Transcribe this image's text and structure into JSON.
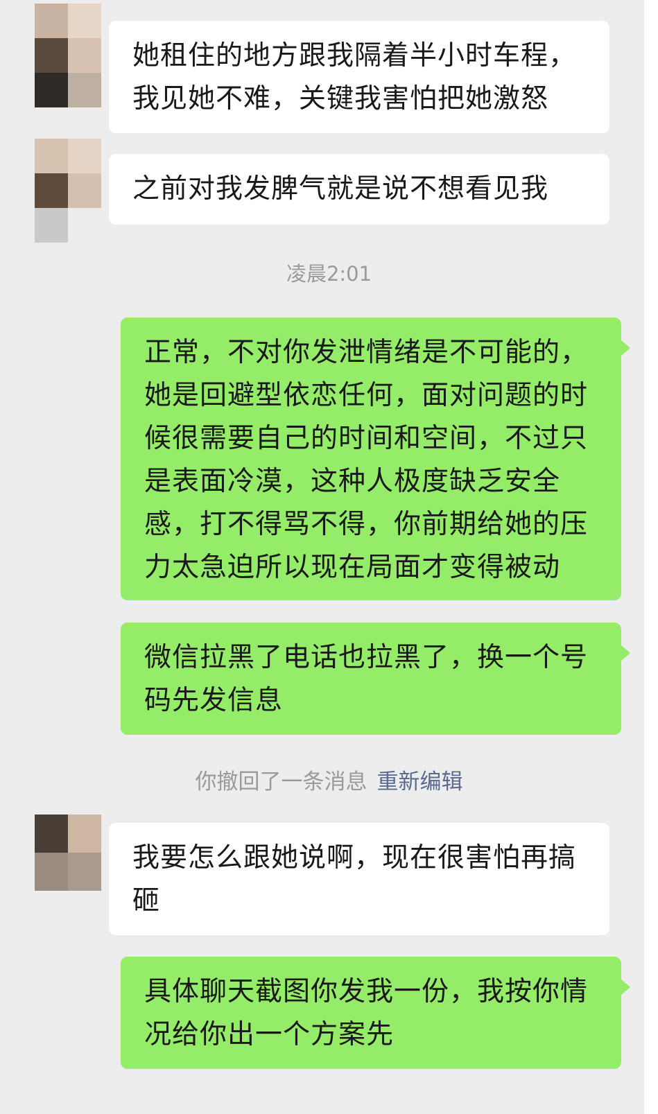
{
  "messages": [
    {
      "side": "in",
      "lines": [
        "她租住的地方跟我隔着半小时车程，",
        "我见她不难，关键我害怕把她激怒"
      ]
    },
    {
      "side": "in",
      "lines": [
        "之前对我发脾气就是说不想看见我"
      ]
    },
    {
      "side": "out",
      "lines": [
        "正常，不对你发泄情绪是不可能的，",
        "她是回避型依恋任何，面对问题的时",
        "候很需要自己的时间和空间，不过只",
        "是表面冷漠，这种人极度缺乏安全",
        "感，打不得骂不得，你前期给她的压",
        "力太急迫所以现在局面才变得被动"
      ]
    },
    {
      "side": "out",
      "lines": [
        "微信拉黑了电话也拉黑了，换一个号",
        "码先发信息"
      ]
    },
    {
      "side": "in",
      "lines": [
        "我要怎么跟她说啊，现在很害怕再搞",
        "砸"
      ]
    },
    {
      "side": "out",
      "lines": [
        "具体聊天截图你发我一份，我按你情",
        "况给你出一个方案先"
      ]
    }
  ],
  "timestamp": "凌晨2:01",
  "recall": {
    "text": "你撤回了一条消息",
    "edit_link": "重新编辑"
  },
  "colors": {
    "background": "#ededed",
    "incoming_bubble": "#ffffff",
    "outgoing_bubble": "#95ec69",
    "link": "#5a6b8f"
  },
  "avatars": [
    {
      "tiles": [
        "#c9b3a3",
        "#e6d6c8",
        "#5a4a3e",
        "#d8c3b3",
        "#2e2a26",
        "#bfb0a4"
      ]
    },
    {
      "tiles": [
        "#d8c2b0",
        "#e6d5c6",
        "#5e4b3c",
        "#d6c1b0",
        "#c9c9c9",
        "#ececec"
      ]
    },
    {
      "tiles": [
        "#4a3f37",
        "#cdb7a3",
        "#9a8b80",
        "#a89a8f"
      ]
    }
  ]
}
